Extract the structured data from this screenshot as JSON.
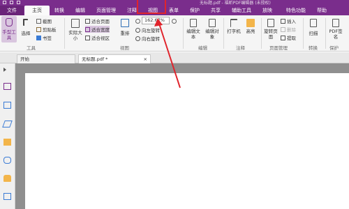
{
  "window": {
    "title": "无标题.pdf - 福昕PDF编辑器 (未授权)"
  },
  "tabs": [
    {
      "label": "文件"
    },
    {
      "label": "主页"
    },
    {
      "label": "转换"
    },
    {
      "label": "编辑"
    },
    {
      "label": "页面管理"
    },
    {
      "label": "注释"
    },
    {
      "label": "视图"
    },
    {
      "label": "表单"
    },
    {
      "label": "保护"
    },
    {
      "label": "共享"
    },
    {
      "label": "辅助工具"
    },
    {
      "label": "放映"
    },
    {
      "label": "特色功能"
    },
    {
      "label": "帮助"
    }
  ],
  "active_tab": "主页",
  "ribbon": {
    "hand_tool": "手型工具",
    "select": "选择",
    "screenshot": "截图",
    "clipboard": "剪贴板",
    "bookmark": "书签",
    "tools_group": "工具",
    "actual_size": "实际大小",
    "fit_page": "适合页面",
    "fit_width": "适合宽度",
    "fit_visible": "适合视区",
    "reflow": "重排",
    "zoom_value": "162.67%",
    "rotate_left": "向左旋转",
    "rotate_right": "向右旋转",
    "view_group": "视图",
    "edit_text": "编辑文本",
    "edit_object": "编辑对象",
    "edit_group": "编辑",
    "typewriter": "打字机",
    "highlight": "高亮",
    "comment_group": "注释",
    "rotate_page": "旋转页面",
    "insert": "插入",
    "delete": "删除",
    "extract": "提取",
    "page_mgmt_group": "页面管理",
    "scan": "扫描",
    "convert_group": "转换",
    "pdf_sign": "PDF签名",
    "protect_group": "保护"
  },
  "doc_tabs": [
    {
      "label": "开始"
    },
    {
      "label": "无标题.pdf *"
    }
  ],
  "colors": {
    "brand": "#7a2d8c",
    "annotation_red": "#e0242c",
    "canvas_gray": "#8f8f8f"
  }
}
